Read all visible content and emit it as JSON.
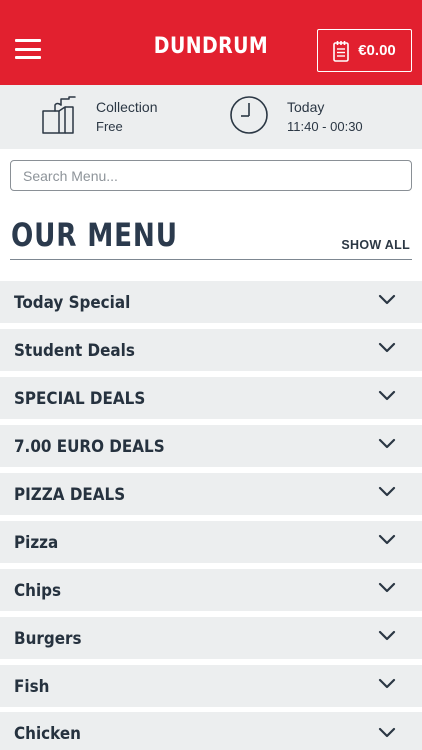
{
  "header": {
    "brand": "DUNDRUM",
    "cart_total": "€0.00",
    "colors": {
      "brand_red": "#e2202f",
      "panel_gray": "#eceeef",
      "text_dark": "#2b3a4d"
    }
  },
  "info": {
    "order_type_title": "Collection",
    "order_type_value": "Free",
    "time_title": "Today",
    "time_value": "11:40 - 00:30"
  },
  "search": {
    "placeholder": "Search Menu..."
  },
  "menu": {
    "title": "OUR MENU",
    "show_all": "SHOW ALL",
    "categories": [
      "Today Special",
      "Student Deals",
      "SPECIAL DEALS",
      "7.00 EURO DEALS",
      "PIZZA DEALS",
      "Pizza",
      "Chips",
      "Burgers",
      "Fish",
      "Chicken"
    ]
  }
}
